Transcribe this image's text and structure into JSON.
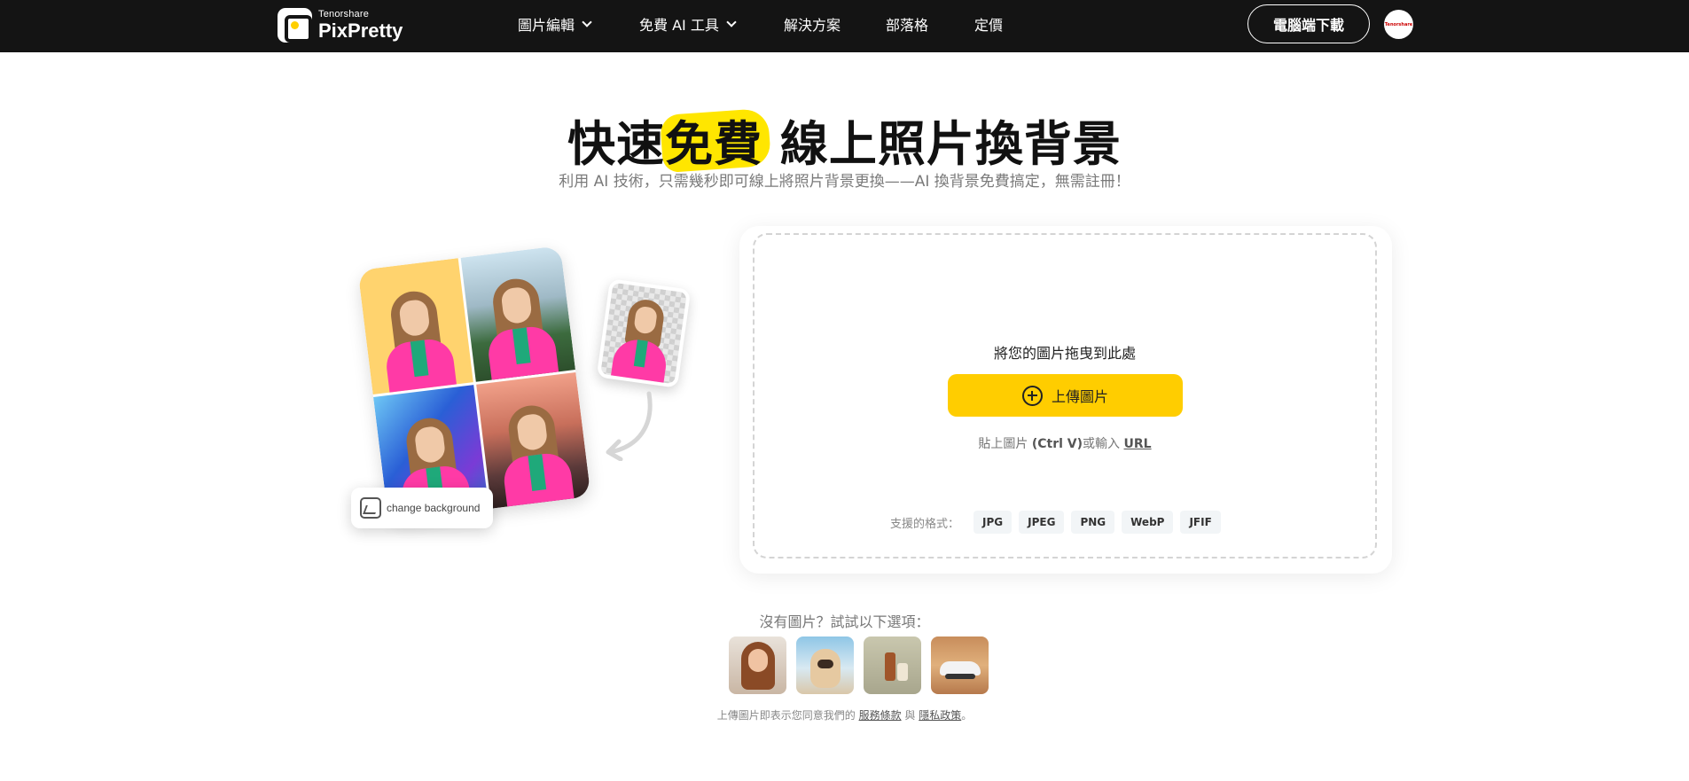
{
  "brand": {
    "company": "Tenorshare",
    "product": "PixPretty"
  },
  "nav": {
    "items": [
      {
        "label": "圖片編輯",
        "has_dropdown": true
      },
      {
        "label": "免費 AI 工具",
        "has_dropdown": true
      },
      {
        "label": "解決方案",
        "has_dropdown": false
      },
      {
        "label": "部落格",
        "has_dropdown": false
      },
      {
        "label": "定價",
        "has_dropdown": false
      }
    ],
    "download_label": "電腦端下載",
    "avatar_text": "Tenorshare"
  },
  "hero": {
    "title_before": "快速",
    "title_highlight": "免費",
    "title_after": " 線上照片換背景",
    "subtitle": "利用 AI 技術，只需幾秒即可線上將照片背景更換——AI 換背景免費搞定，無需註冊！"
  },
  "illustration": {
    "chip_label": "change background"
  },
  "upload": {
    "drop_text": "將您的圖片拖曳到此處",
    "button_label": "上傳圖片",
    "paste_prefix": "貼上圖片 ",
    "paste_shortcut": "(Ctrl V)",
    "paste_middle": "或輸入 ",
    "url_label": "URL",
    "formats_label": "支援的格式：",
    "formats": [
      "JPG",
      "JPEG",
      "PNG",
      "WebP",
      "JFIF"
    ]
  },
  "samples": {
    "title": "沒有圖片？試試以下選項：",
    "items": [
      "sample-portrait",
      "sample-dog",
      "sample-bottles",
      "sample-car"
    ]
  },
  "terms": {
    "prefix": "上傳圖片即表示您同意我們的 ",
    "service_label": "服務條款",
    "and": " 與 ",
    "privacy_label": "隱私政策",
    "suffix": "。"
  },
  "colors": {
    "nav_bg": "#141414",
    "accent_yellow": "#ffcd00",
    "highlight_yellow": "#ffe600"
  }
}
